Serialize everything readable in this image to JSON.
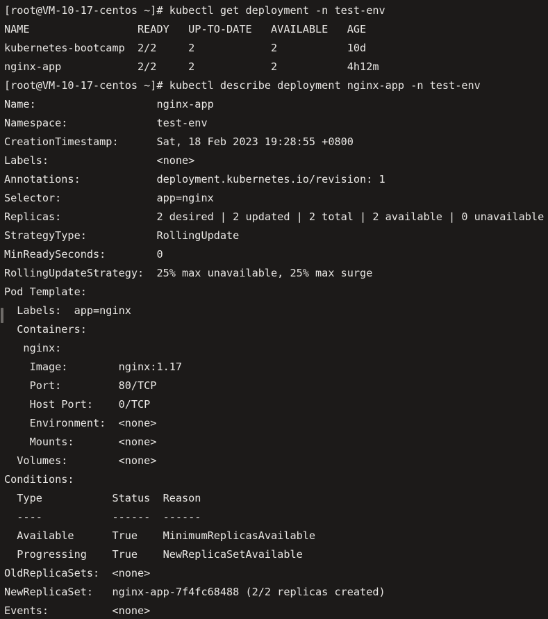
{
  "terminal": {
    "title": "root@VM-10-17-centos terminal",
    "background_color": "#1c1a19",
    "foreground_color": "#e9e7e4",
    "scrollbar_color": "#6e6b68",
    "prompt": "[root@VM-10-17-centos ~]#",
    "hostname": "VM-10-17-centos",
    "user": "root",
    "cwd": "~",
    "commands": [
      "kubectl get deployment -n test-env",
      "kubectl describe deployment nginx-app -n test-env"
    ],
    "get_deployment_table": {
      "headers": [
        "NAME",
        "READY",
        "UP-TO-DATE",
        "AVAILABLE",
        "AGE"
      ],
      "rows": [
        [
          "kubernetes-bootcamp",
          "2/2",
          "2",
          "2",
          "10d"
        ],
        [
          "nginx-app",
          "2/2",
          "2",
          "2",
          "4h12m"
        ]
      ]
    },
    "describe": {
      "name": "nginx-app",
      "namespace": "test-env",
      "creation_timestamp": "Sat, 18 Feb 2023 19:28:55 +0800",
      "labels": "<none>",
      "annotations": "deployment.kubernetes.io/revision: 1",
      "selector": "app=nginx",
      "replicas": "2 desired | 2 updated | 2 total | 2 available | 0 unavailable",
      "strategy_type": "RollingUpdate",
      "min_ready_seconds": "0",
      "rolling_update_strategy": "25% max unavailable, 25% max surge",
      "pod_template": {
        "labels": "app=nginx",
        "containers": {
          "container_name": "nginx",
          "image": "nginx:1.17",
          "port": "80/TCP",
          "host_port": "0/TCP",
          "environment": "<none>",
          "mounts": "<none>"
        },
        "volumes": "<none>"
      },
      "conditions": {
        "headers": [
          "Type",
          "Status",
          "Reason"
        ],
        "separators": [
          "----",
          "------",
          "------"
        ],
        "rows": [
          [
            "Available",
            "True",
            "MinimumReplicasAvailable"
          ],
          [
            "Progressing",
            "True",
            "NewReplicaSetAvailable"
          ]
        ]
      },
      "old_replica_sets": "<none>",
      "new_replica_set": "nginx-app-7f4fc68488 (2/2 replicas created)",
      "events": "<none>"
    }
  },
  "lines": [
    "[root@VM-10-17-centos ~]# kubectl get deployment -n test-env",
    "NAME                 READY   UP-TO-DATE   AVAILABLE   AGE",
    "kubernetes-bootcamp  2/2     2            2           10d",
    "nginx-app            2/2     2            2           4h12m",
    "[root@VM-10-17-centos ~]# kubectl describe deployment nginx-app -n test-env",
    "Name:                   nginx-app",
    "Namespace:              test-env",
    "CreationTimestamp:      Sat, 18 Feb 2023 19:28:55 +0800",
    "Labels:                 <none>",
    "Annotations:            deployment.kubernetes.io/revision: 1",
    "Selector:               app=nginx",
    "Replicas:               2 desired | 2 updated | 2 total | 2 available | 0 unavailable",
    "StrategyType:           RollingUpdate",
    "MinReadySeconds:        0",
    "RollingUpdateStrategy:  25% max unavailable, 25% max surge",
    "Pod Template:",
    "  Labels:  app=nginx",
    "  Containers:",
    "   nginx:",
    "    Image:        nginx:1.17",
    "    Port:         80/TCP",
    "    Host Port:    0/TCP",
    "    Environment:  <none>",
    "    Mounts:       <none>",
    "  Volumes:        <none>",
    "Conditions:",
    "  Type           Status  Reason",
    "  ----           ------  ------",
    "  Available      True    MinimumReplicasAvailable",
    "  Progressing    True    NewReplicaSetAvailable",
    "OldReplicaSets:  <none>",
    "NewReplicaSet:   nginx-app-7f4fc68488 (2/2 replicas created)",
    "Events:          <none>"
  ]
}
